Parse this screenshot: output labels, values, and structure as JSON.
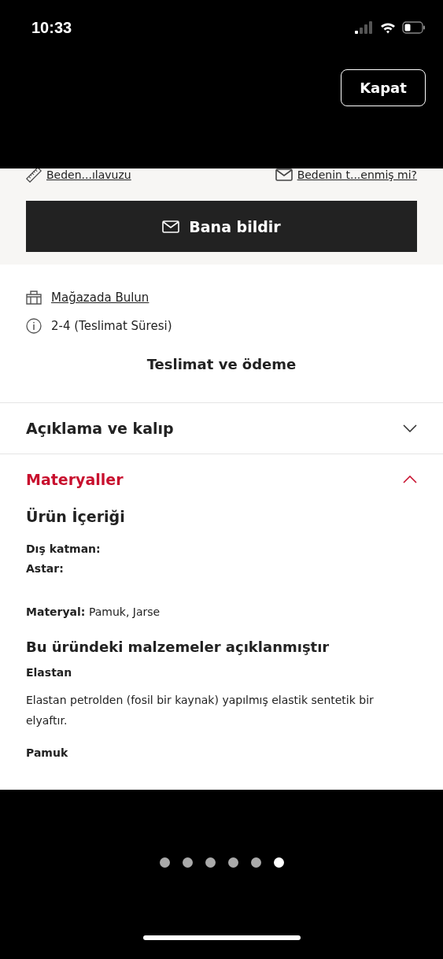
{
  "status_bar": {
    "time": "10:33"
  },
  "close_button": "Kapat",
  "links": [
    {
      "kind": "ruler",
      "label": "Beden...ılavuzu"
    },
    {
      "kind": "mail",
      "label": "Bedenin t...enmiş mi?"
    }
  ],
  "notify_button": "Bana bildir",
  "store_link": "Mağazada Bulun",
  "delivery_info": "2-4 (Teslimat Süresi)",
  "delivery_payment": "Teslimat ve ödeme",
  "accordion": [
    {
      "title": "Açıklama ve kalıp",
      "expanded": false
    },
    {
      "title": "Materyaller",
      "expanded": true
    }
  ],
  "materials": {
    "heading": "Ürün İçeriği",
    "lines": [
      "Dış katman:",
      "Astar:"
    ],
    "material_line": "**Materyal:** Pamuk, Jarse",
    "disclosure_heading": "Bu üründeki malzemeler açıklanmıştır",
    "items": [
      {
        "name": "Elastan",
        "description": "Elastan petrolden (fosil bir kaynak) yapılmış elastik sentetik bir elyaftır."
      },
      {
        "name": "Pamuk"
      }
    ]
  },
  "pager": [
    {
      "selected": false
    },
    {
      "selected": false
    },
    {
      "selected": false
    },
    {
      "selected": false
    },
    {
      "selected": false
    },
    {
      "selected": true
    }
  ]
}
